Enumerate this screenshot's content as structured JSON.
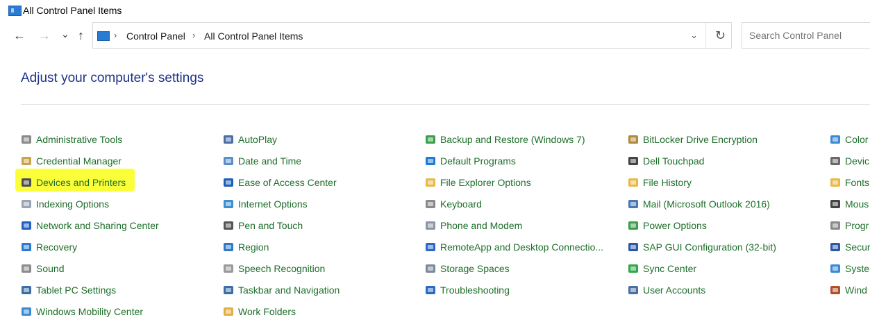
{
  "window": {
    "title": "All Control Panel Items"
  },
  "navigation": {
    "back_glyph": "←",
    "forward_glyph": "→",
    "recent_glyph": "⌄",
    "up_glyph": "↑",
    "breadcrumb": [
      "Control Panel",
      "All Control Panel Items"
    ],
    "separator_glyph": "›",
    "dropdown_glyph": "⌄",
    "refresh_glyph": "↻",
    "search_placeholder": "Search Control Panel"
  },
  "heading": "Adjust your computer's settings",
  "colors": {
    "link": "#1e6e2a",
    "heading": "#1e3287",
    "highlight": "#fbff3a"
  },
  "columns": [
    [
      {
        "label": "Administrative Tools",
        "icon": "administrative-tools-icon",
        "color": "#8a8a8a"
      },
      {
        "label": "Credential Manager",
        "icon": "credential-manager-icon",
        "color": "#c9a24a"
      },
      {
        "label": "Devices and Printers",
        "icon": "devices-and-printers-icon",
        "color": "#4d4d4d"
      },
      {
        "label": "Indexing Options",
        "icon": "indexing-options-icon",
        "color": "#9aa4b2"
      },
      {
        "label": "Network and Sharing Center",
        "icon": "network-sharing-icon",
        "color": "#2060c0"
      },
      {
        "label": "Recovery",
        "icon": "recovery-icon",
        "color": "#2a7bd4"
      },
      {
        "label": "Sound",
        "icon": "sound-icon",
        "color": "#8c8c8c"
      },
      {
        "label": "Tablet PC Settings",
        "icon": "tablet-pc-icon",
        "color": "#3a6ea5"
      },
      {
        "label": "Windows Mobility Center",
        "icon": "mobility-center-icon",
        "color": "#3a8ad4"
      }
    ],
    [
      {
        "label": "AutoPlay",
        "icon": "autoplay-icon",
        "color": "#4a6fa5"
      },
      {
        "label": "Date and Time",
        "icon": "date-time-icon",
        "color": "#5a8fc9"
      },
      {
        "label": "Ease of Access Center",
        "icon": "ease-of-access-icon",
        "color": "#1f5fb5"
      },
      {
        "label": "Internet Options",
        "icon": "internet-options-icon",
        "color": "#3c8fd1"
      },
      {
        "label": "Pen and Touch",
        "icon": "pen-touch-icon",
        "color": "#555555"
      },
      {
        "label": "Region",
        "icon": "region-icon",
        "color": "#2f79c8"
      },
      {
        "label": "Speech Recognition",
        "icon": "speech-recognition-icon",
        "color": "#9a9a9a"
      },
      {
        "label": "Taskbar and Navigation",
        "icon": "taskbar-icon",
        "color": "#3a6ea5"
      },
      {
        "label": "Work Folders",
        "icon": "work-folders-icon",
        "color": "#e0b040"
      }
    ],
    [
      {
        "label": "Backup and Restore (Windows 7)",
        "icon": "backup-restore-icon",
        "color": "#3aa04a"
      },
      {
        "label": "Default Programs",
        "icon": "default-programs-icon",
        "color": "#1f7ad4"
      },
      {
        "label": "File Explorer Options",
        "icon": "file-explorer-options-icon",
        "color": "#e8b84a"
      },
      {
        "label": "Keyboard",
        "icon": "keyboard-icon",
        "color": "#8a8a8a"
      },
      {
        "label": "Phone and Modem",
        "icon": "phone-modem-icon",
        "color": "#8a96a6"
      },
      {
        "label": "RemoteApp and Desktop Connectio...",
        "icon": "remoteapp-icon",
        "color": "#2a6ac4"
      },
      {
        "label": "Storage Spaces",
        "icon": "storage-spaces-icon",
        "color": "#7a8a9a"
      },
      {
        "label": "Troubleshooting",
        "icon": "troubleshooting-icon",
        "color": "#2a6ac4"
      }
    ],
    [
      {
        "label": "BitLocker Drive Encryption",
        "icon": "bitlocker-icon",
        "color": "#b08a3a"
      },
      {
        "label": "Dell Touchpad",
        "icon": "touchpad-icon",
        "color": "#444444"
      },
      {
        "label": "File History",
        "icon": "file-history-icon",
        "color": "#e8b84a"
      },
      {
        "label": "Mail (Microsoft Outlook 2016)",
        "icon": "mail-icon",
        "color": "#4a7ab5"
      },
      {
        "label": "Power Options",
        "icon": "power-options-icon",
        "color": "#3aa04a"
      },
      {
        "label": "SAP GUI Configuration (32-bit)",
        "icon": "sap-gui-icon",
        "color": "#2a5aa5"
      },
      {
        "label": "Sync Center",
        "icon": "sync-center-icon",
        "color": "#2fa84a"
      },
      {
        "label": "User Accounts",
        "icon": "user-accounts-icon",
        "color": "#4a6fa5"
      }
    ],
    [
      {
        "label": "Color",
        "icon": "color-management-icon",
        "color": "#3a8ad4"
      },
      {
        "label": "Devic",
        "icon": "device-manager-icon",
        "color": "#6a6a6a"
      },
      {
        "label": "Fonts",
        "icon": "fonts-icon",
        "color": "#e8b84a"
      },
      {
        "label": "Mous",
        "icon": "mouse-icon",
        "color": "#444444"
      },
      {
        "label": "Progr",
        "icon": "programs-icon",
        "color": "#8a8a8a"
      },
      {
        "label": "Secur",
        "icon": "security-icon",
        "color": "#2a5aa5"
      },
      {
        "label": "Syster",
        "icon": "system-icon",
        "color": "#3a8ad4"
      },
      {
        "label": "Wind",
        "icon": "windows-firewall-icon",
        "color": "#b0502a"
      }
    ]
  ]
}
